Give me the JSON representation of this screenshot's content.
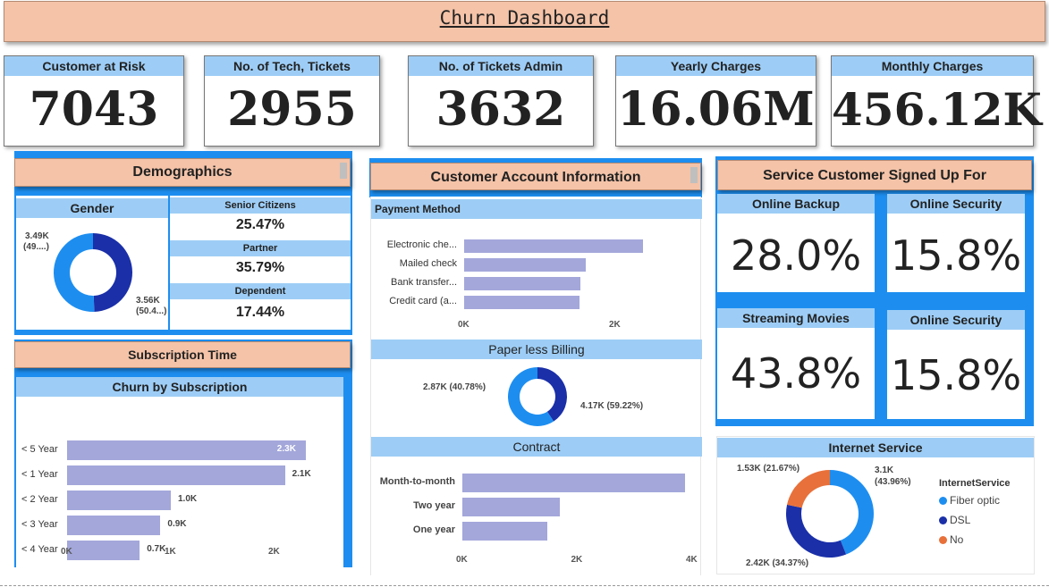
{
  "title": "Churn Dashboard",
  "kpis": [
    {
      "label": "Customer at Risk",
      "value": "7043"
    },
    {
      "label": "No. of Tech, Tickets",
      "value": "2955"
    },
    {
      "label": "No. of Tickets Admin",
      "value": "3632"
    },
    {
      "label": "Yearly Charges",
      "value": "16.06M"
    },
    {
      "label": "Monthly Charges",
      "value": "456.12K"
    }
  ],
  "demographics": {
    "title": "Demographics",
    "gender_title": "Gender",
    "gender_labels": [
      "3.49K",
      "(49....)",
      "3.56K",
      "(50.4...)"
    ],
    "stats": [
      {
        "label": "Senior Citizens",
        "value": "25.47%"
      },
      {
        "label": "Partner",
        "value": "35.79%"
      },
      {
        "label": "Dependent",
        "value": "17.44%"
      }
    ]
  },
  "subscription": {
    "title": "Subscription Time",
    "chart_title": "Churn by Subscription"
  },
  "account": {
    "title": "Customer Account Information",
    "payment_title": "Payment Method",
    "paperless_title": "Paper less Billing",
    "paperless_labels": [
      "2.87K (40.78%)",
      "4.17K (59.22%)"
    ],
    "contract_title": "Contract"
  },
  "services": {
    "title": "Service Customer Signed Up For",
    "tiles": [
      {
        "label": "Online Backup",
        "value": "28.0%"
      },
      {
        "label": "Online Security",
        "value": "15.8%"
      },
      {
        "label": "Streaming Movies",
        "value": "43.8%"
      },
      {
        "label": "Online Security",
        "value": "15.8%"
      }
    ],
    "internet_title": "Internet Service",
    "internet_labels": [
      "1.53K (21.67%)",
      "3.1K",
      "(43.96%)",
      "2.42K (34.37%)"
    ],
    "legend_title": "InternetService"
  },
  "colors": {
    "accent": "#1d8ef0",
    "light": "#9dcdf6",
    "header": "#f4c3a8",
    "bar": "#a3a7da",
    "dark_blue": "#1a2fa8",
    "orange": "#e8703a"
  },
  "chart_data": [
    {
      "type": "pie",
      "title": "Gender",
      "labels": [],
      "values": [
        3490,
        3560
      ],
      "display": [
        "3.49K (49....)",
        "3.56K (50.4...)"
      ],
      "colors": [
        "#1a2fa8",
        "#1d8ef0"
      ]
    },
    {
      "type": "bar",
      "title": "Churn by Subscription",
      "categories": [
        "< 5 Year",
        "< 1 Year",
        "< 2 Year",
        "< 3 Year",
        "< 4 Year"
      ],
      "values": [
        2300,
        2100,
        1000,
        900,
        700
      ],
      "data_labels": [
        "2.3K",
        "2.1K",
        "1.0K",
        "0.9K",
        "0.7K"
      ],
      "xticks": [
        "0K",
        "1K",
        "2K"
      ],
      "xlim": [
        0,
        2500
      ]
    },
    {
      "type": "bar",
      "title": "Payment Method",
      "categories": [
        "Electronic che...",
        "Mailed check",
        "Bank transfer...",
        "Credit card (a..."
      ],
      "values": [
        2365,
        1612,
        1544,
        1522
      ],
      "xticks": [
        "0K",
        "2K"
      ],
      "xlim": [
        0,
        3000
      ]
    },
    {
      "type": "pie",
      "title": "Paper less Billing",
      "labels": [],
      "values": [
        2870,
        4170
      ],
      "display": [
        "2.87K (40.78%)",
        "4.17K (59.22%)"
      ],
      "colors": [
        "#1a2fa8",
        "#1d8ef0"
      ]
    },
    {
      "type": "bar",
      "title": "Contract",
      "categories": [
        "Month-to-month",
        "Two year",
        "One year"
      ],
      "values": [
        3875,
        1695,
        1473
      ],
      "xticks": [
        "0K",
        "2K",
        "4K"
      ],
      "xlim": [
        0,
        4000
      ]
    },
    {
      "type": "pie",
      "title": "Internet Service",
      "legend_title": "InternetService",
      "labels": [
        "Fiber optic",
        "DSL",
        "No"
      ],
      "values": [
        3100,
        2420,
        1530
      ],
      "display": [
        "3.1K (43.96%)",
        "2.42K (34.37%)",
        "1.53K (21.67%)"
      ],
      "colors": [
        "#1d8ef0",
        "#1a2fa8",
        "#e8703a"
      ]
    }
  ]
}
